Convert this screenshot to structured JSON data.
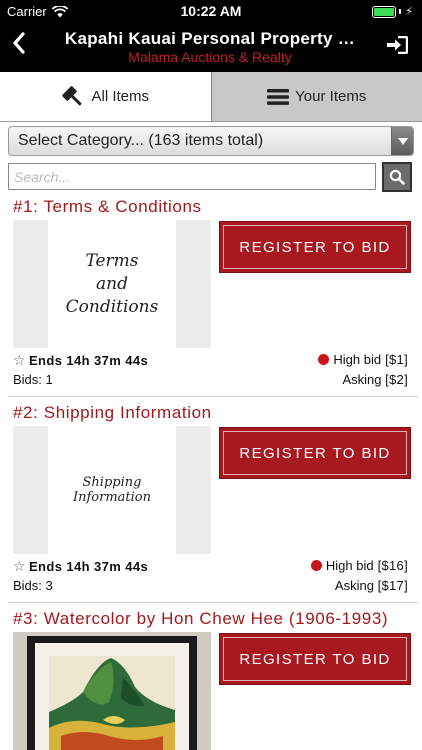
{
  "status_bar": {
    "carrier": "Carrier",
    "time": "10:22 AM"
  },
  "nav": {
    "back_label": "‹",
    "title": "Kapahi Kauai Personal Property …",
    "subtitle": "Malama Auctions & Realty"
  },
  "tabs": [
    {
      "label": "All Items",
      "active": true,
      "icon": "gavel-icon"
    },
    {
      "label": "Your Items",
      "active": false,
      "icon": "list-icon"
    }
  ],
  "category_select": {
    "label": "Select Category... (163 items total)"
  },
  "search": {
    "placeholder": "Search..."
  },
  "colors": {
    "accent": "#a8191f",
    "title_red": "#a3191e",
    "header_bg": "#000000",
    "bid_dot": "#c8151c"
  },
  "items": [
    {
      "title": "#1: Terms & Conditions",
      "thumb_text": [
        "Terms",
        "and",
        "Conditions"
      ],
      "button": "REGISTER TO BID",
      "ends": "Ends 14h 37m 44s",
      "bids": "Bids: 1",
      "high_bid_label": "High bid",
      "high_bid_value": "[$1]",
      "asking_label": "Asking",
      "asking_value": "[$2]"
    },
    {
      "title": "#2: Shipping Information",
      "thumb_text": [
        "Shipping Information"
      ],
      "button": "REGISTER TO BID",
      "ends": "Ends 14h 37m 44s",
      "bids": "Bids: 3",
      "high_bid_label": "High bid",
      "high_bid_value": "[$16]",
      "asking_label": "Asking",
      "asking_value": "[$17]"
    },
    {
      "title": "#3: Watercolor by Hon Chew Hee (1906-1993)",
      "button": "REGISTER TO BID"
    }
  ]
}
